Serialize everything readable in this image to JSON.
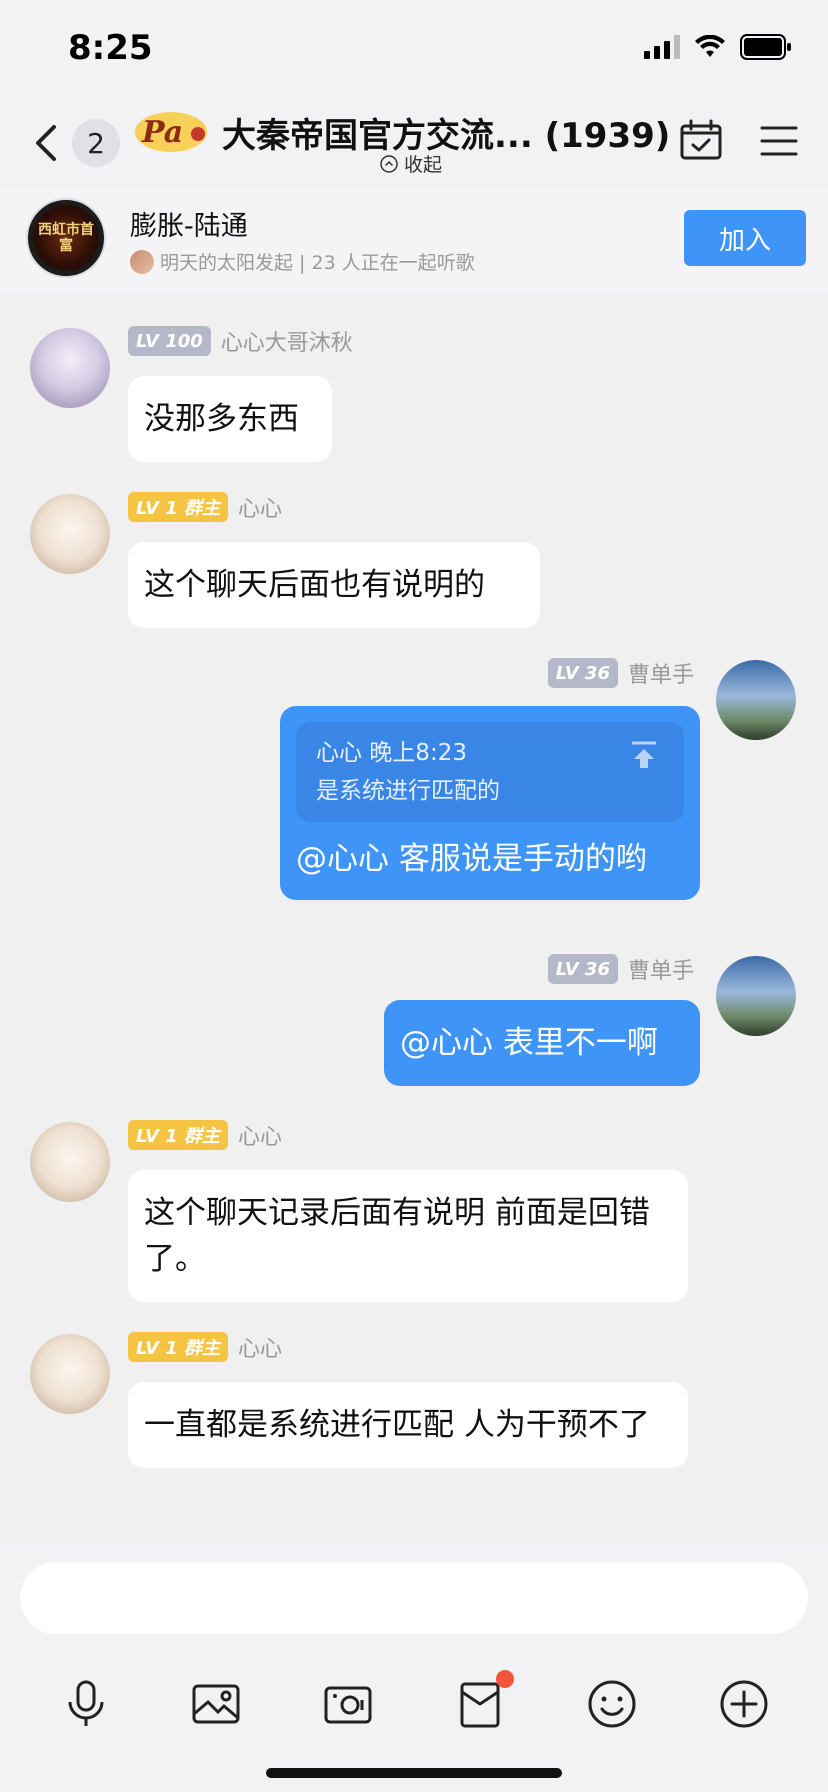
{
  "status_bar": {
    "time": "8:25"
  },
  "nav": {
    "back_count": "2",
    "logo_text": "Pa",
    "title": "大秦帝国官方交流... (1939)",
    "collapse_label": "收起"
  },
  "music": {
    "cover_text": "西虹市首富",
    "title": "膨胀-陆通",
    "subtitle": "明天的太阳发起 | 23 人正在一起听歌",
    "join_label": "加入"
  },
  "messages": [
    {
      "side": "left",
      "level": "LV 100",
      "nick": "心心大哥沐秋",
      "text": "没那多东西"
    },
    {
      "side": "left",
      "level": "LV 1 群主",
      "nick": "心心",
      "text": "这个聊天后面也有说明的"
    },
    {
      "side": "right",
      "level": "LV 36",
      "nick": "曹单手",
      "quote_head": "心心 晚上8:23",
      "quote_text": "是系统进行匹配的",
      "text": "@心心 客服说是手动的哟"
    },
    {
      "side": "right",
      "level": "LV 36",
      "nick": "曹单手",
      "text": "@心心 表里不一啊"
    },
    {
      "side": "left",
      "level": "LV 1 群主",
      "nick": "心心",
      "text": "这个聊天记录后面有说明 前面是回错了。"
    },
    {
      "side": "left",
      "level": "LV 1 群主",
      "nick": "心心",
      "text": "一直都是系统进行匹配 人为干预不了"
    }
  ],
  "toolbar": {
    "items": [
      "microphone-icon",
      "image-icon",
      "camera-icon",
      "red-packet-icon",
      "emoji-icon",
      "plus-icon"
    ]
  },
  "colors": {
    "accent": "#3f94f7",
    "gold_badge": "#f6c443",
    "gray_badge": "#b5b8c8",
    "notification": "#f2543e"
  }
}
